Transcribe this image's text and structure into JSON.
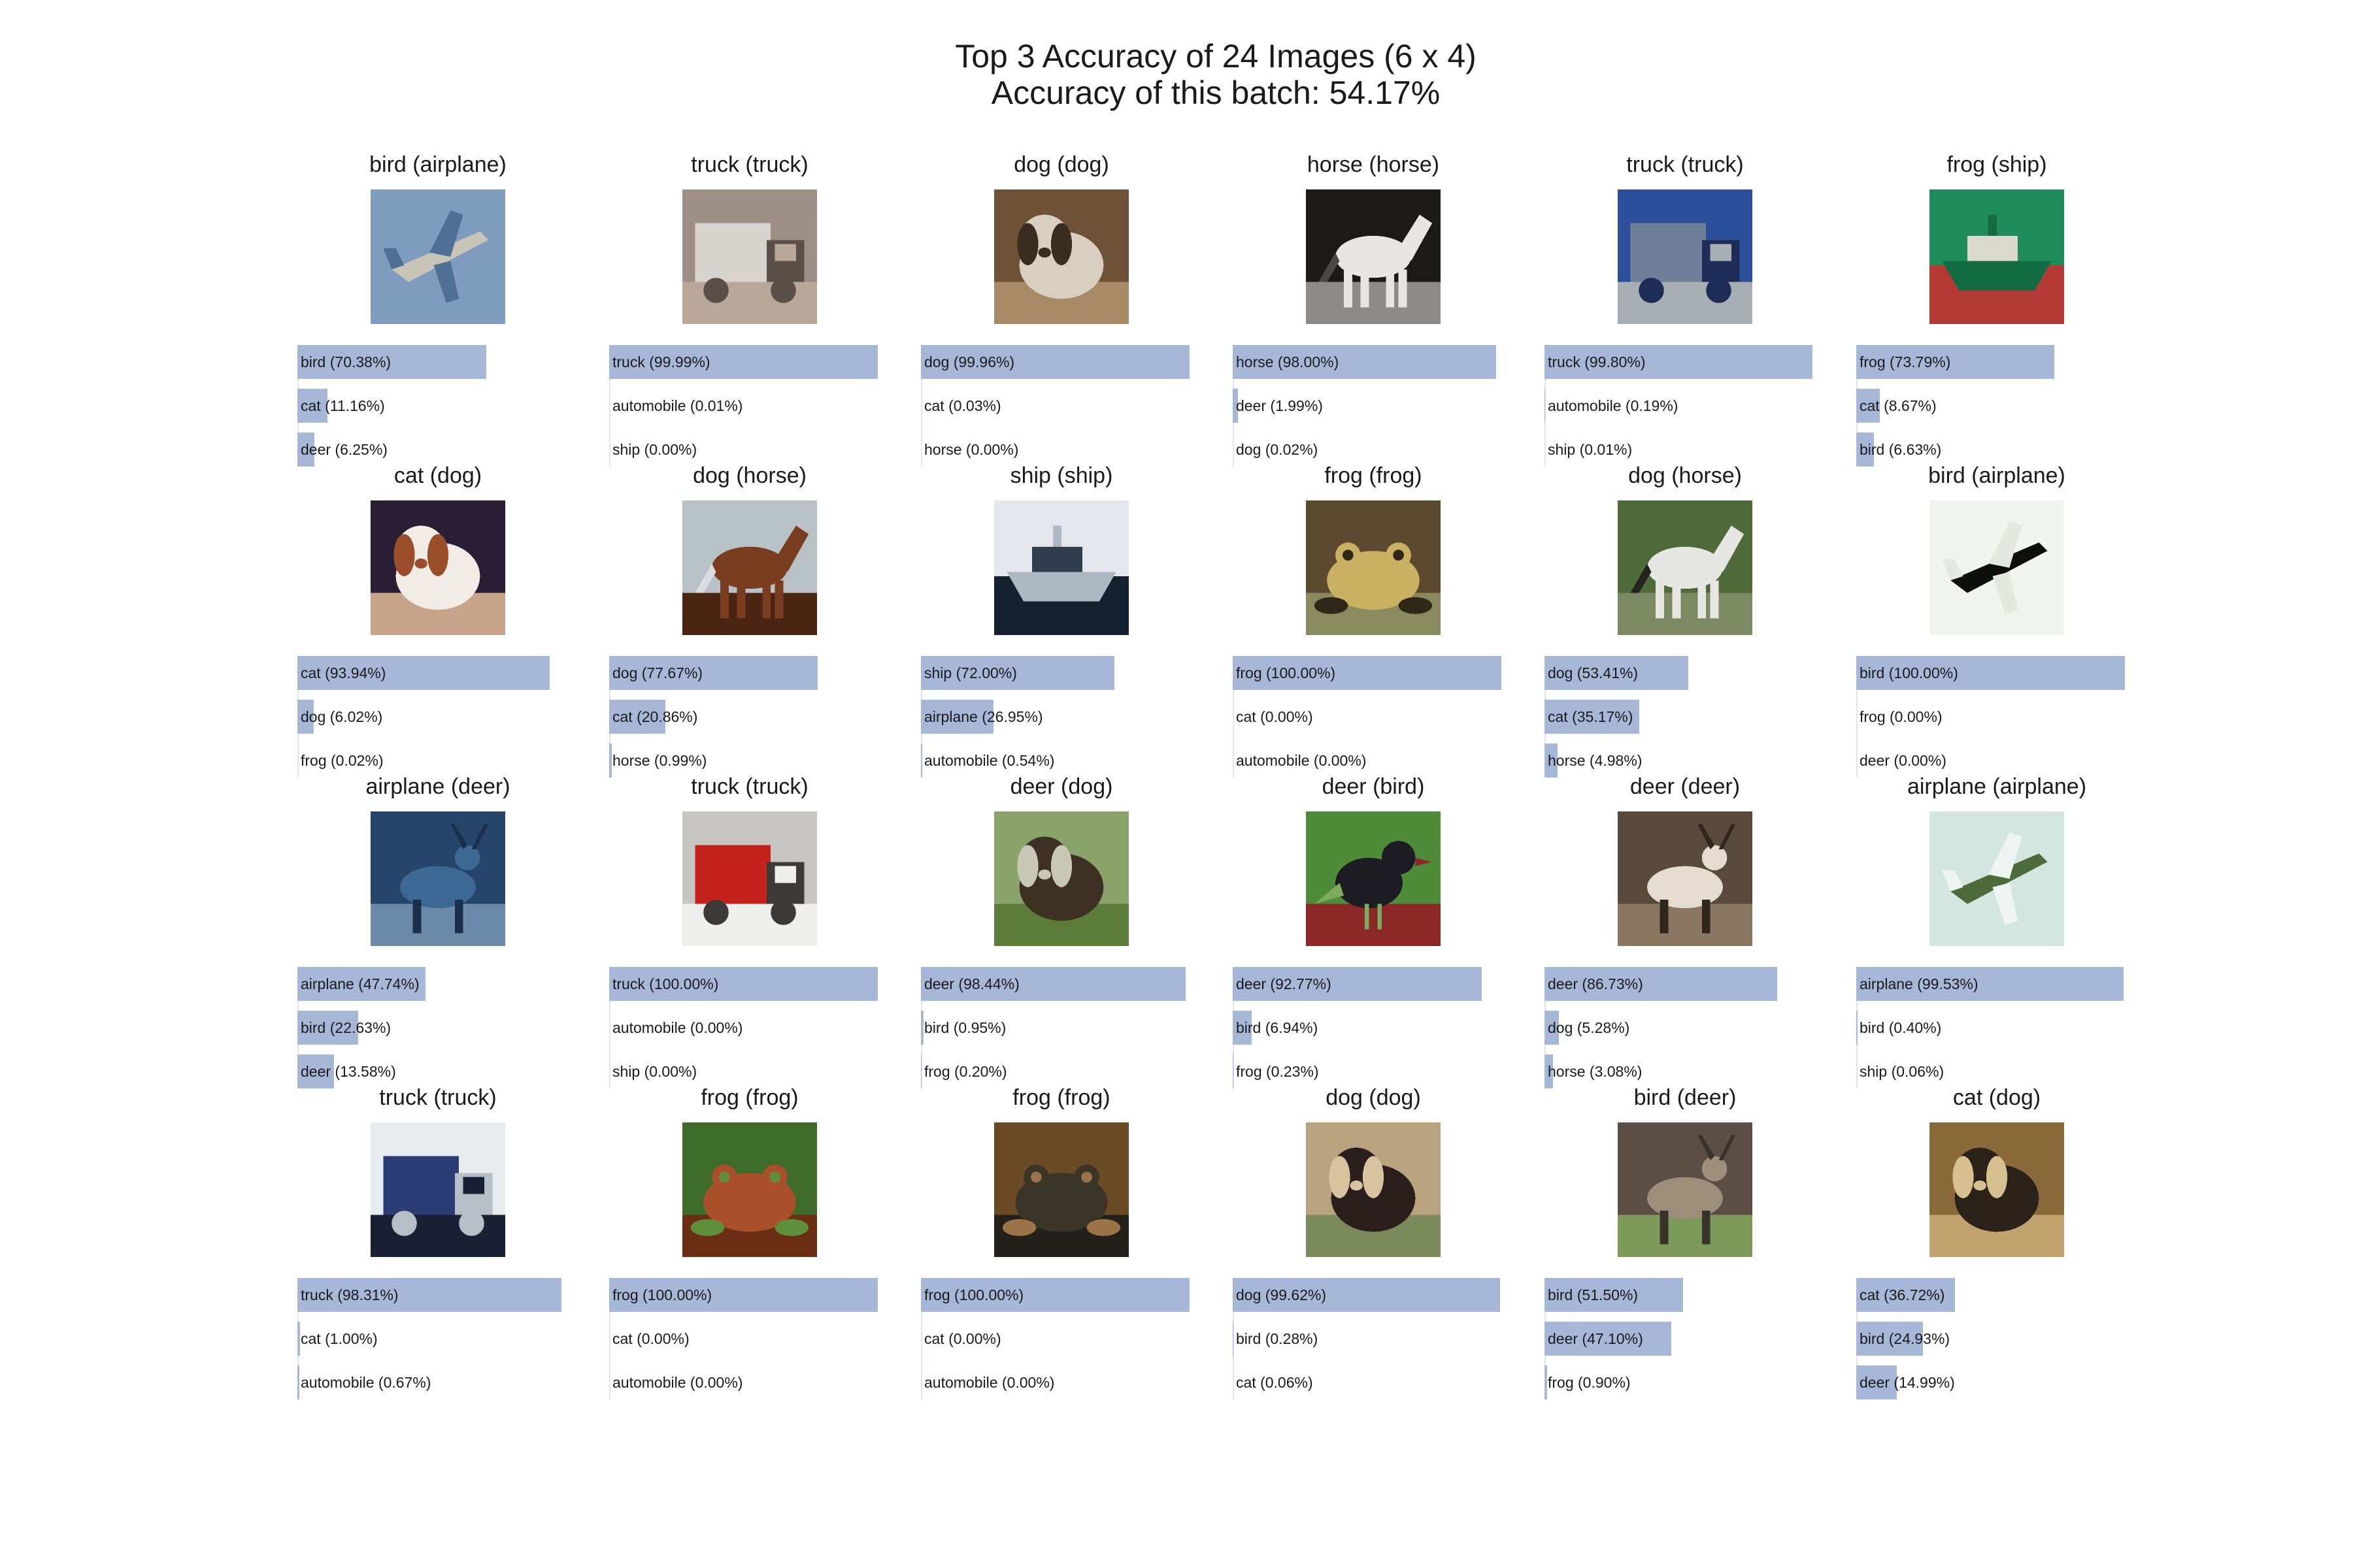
{
  "title_line1": "Top 3 Accuracy of 24 Images (6 x 4)",
  "title_line2": "Accuracy of this batch: 54.17%",
  "chart_data": {
    "type": "bar",
    "grid": false,
    "layout": "6 columns x 4 rows of image panels, each with a horizontal top-3 probability bar chart",
    "colors": {
      "bar": "#a6b7d8",
      "text": "#1a1a1a"
    },
    "cells": [
      {
        "title": "bird (airplane)",
        "image": "airplane",
        "palette": [
          "#7f9cbf",
          "#c9c4b8",
          "#4f6f94",
          "#9fb6cf"
        ],
        "preds": [
          {
            "label": "bird (70.38%)",
            "value": 70.38
          },
          {
            "label": "cat (11.16%)",
            "value": 11.16
          },
          {
            "label": "deer (6.25%)",
            "value": 6.25
          }
        ]
      },
      {
        "title": "truck (truck)",
        "image": "truck",
        "palette": [
          "#9e8f86",
          "#d7d4d0",
          "#5b4f49",
          "#b9a79a"
        ],
        "preds": [
          {
            "label": "truck (99.99%)",
            "value": 99.99
          },
          {
            "label": "automobile (0.01%)",
            "value": 0.01
          },
          {
            "label": "ship (0.00%)",
            "value": 0.0
          }
        ]
      },
      {
        "title": "dog (dog)",
        "image": "dog",
        "palette": [
          "#6e5238",
          "#d8cfc1",
          "#3a2c1f",
          "#a98a66"
        ],
        "preds": [
          {
            "label": "dog (99.96%)",
            "value": 99.96
          },
          {
            "label": "cat (0.03%)",
            "value": 0.03
          },
          {
            "label": "horse (0.00%)",
            "value": 0.0
          }
        ]
      },
      {
        "title": "horse (horse)",
        "image": "horse",
        "palette": [
          "#1b1a19",
          "#e8e6e3",
          "#4a4745",
          "#8d8a87"
        ],
        "preds": [
          {
            "label": "horse (98.00%)",
            "value": 98.0
          },
          {
            "label": "deer (1.99%)",
            "value": 1.99
          },
          {
            "label": "dog (0.02%)",
            "value": 0.02
          }
        ]
      },
      {
        "title": "truck (truck)",
        "image": "truck",
        "palette": [
          "#2c4f9a",
          "#6f7f9a",
          "#1d2d57",
          "#a7aeb4"
        ],
        "preds": [
          {
            "label": "truck (99.80%)",
            "value": 99.8
          },
          {
            "label": "automobile (0.19%)",
            "value": 0.19
          },
          {
            "label": "ship (0.01%)",
            "value": 0.01
          }
        ]
      },
      {
        "title": "frog (ship)",
        "image": "ship",
        "palette": [
          "#1f8a5a",
          "#d9d9cf",
          "#126b43",
          "#b43a36"
        ],
        "preds": [
          {
            "label": "frog (73.79%)",
            "value": 73.79
          },
          {
            "label": "cat (8.67%)",
            "value": 8.67
          },
          {
            "label": "bird (6.63%)",
            "value": 6.63
          }
        ]
      },
      {
        "title": "cat (dog)",
        "image": "dog",
        "palette": [
          "#2a1e35",
          "#f1ece6",
          "#9b4e2a",
          "#c7a48a"
        ],
        "preds": [
          {
            "label": "cat (93.94%)",
            "value": 93.94
          },
          {
            "label": "dog (6.02%)",
            "value": 6.02
          },
          {
            "label": "frog (0.02%)",
            "value": 0.02
          }
        ]
      },
      {
        "title": "dog (horse)",
        "image": "horse",
        "palette": [
          "#b8c1c6",
          "#7a3d20",
          "#d9dde0",
          "#4a2412"
        ],
        "preds": [
          {
            "label": "dog (77.67%)",
            "value": 77.67
          },
          {
            "label": "cat (20.86%)",
            "value": 20.86
          },
          {
            "label": "horse (0.99%)",
            "value": 0.99
          }
        ]
      },
      {
        "title": "ship (ship)",
        "image": "ship",
        "palette": [
          "#e4e8ee",
          "#2f3d4c",
          "#aeb8c4",
          "#14212e"
        ],
        "preds": [
          {
            "label": "ship (72.00%)",
            "value": 72.0
          },
          {
            "label": "airplane (26.95%)",
            "value": 26.95
          },
          {
            "label": "automobile (0.54%)",
            "value": 0.54
          }
        ]
      },
      {
        "title": "frog (frog)",
        "image": "frog",
        "palette": [
          "#5b4a30",
          "#c9b063",
          "#2f2718",
          "#8a8a5e"
        ],
        "preds": [
          {
            "label": "frog (100.00%)",
            "value": 100.0
          },
          {
            "label": "cat (0.00%)",
            "value": 0.0
          },
          {
            "label": "automobile (0.00%)",
            "value": 0.0
          }
        ]
      },
      {
        "title": "dog (horse)",
        "image": "horse",
        "palette": [
          "#4f6b3a",
          "#e6e7e2",
          "#24231f",
          "#7c8a63"
        ],
        "preds": [
          {
            "label": "dog (53.41%)",
            "value": 53.41
          },
          {
            "label": "cat (35.17%)",
            "value": 35.17
          },
          {
            "label": "horse (4.98%)",
            "value": 4.98
          }
        ]
      },
      {
        "title": "bird (airplane)",
        "image": "airplane",
        "palette": [
          "#f2f4ef",
          "#0d0f0c",
          "#e5e8e0",
          "#3a3c38"
        ],
        "preds": [
          {
            "label": "bird (100.00%)",
            "value": 100.0
          },
          {
            "label": "frog (0.00%)",
            "value": 0.0
          },
          {
            "label": "deer (0.00%)",
            "value": 0.0
          }
        ]
      },
      {
        "title": "airplane (deer)",
        "image": "deer",
        "palette": [
          "#27456b",
          "#3d6a95",
          "#1a2f4a",
          "#6b88a8"
        ],
        "preds": [
          {
            "label": "airplane (47.74%)",
            "value": 47.74
          },
          {
            "label": "bird (22.63%)",
            "value": 22.63
          },
          {
            "label": "deer (13.58%)",
            "value": 13.58
          }
        ]
      },
      {
        "title": "truck (truck)",
        "image": "truck",
        "palette": [
          "#c8c6c2",
          "#c4221d",
          "#3c3a37",
          "#eeeeec"
        ],
        "preds": [
          {
            "label": "truck (100.00%)",
            "value": 100.0
          },
          {
            "label": "automobile (0.00%)",
            "value": 0.0
          },
          {
            "label": "ship (0.00%)",
            "value": 0.0
          }
        ]
      },
      {
        "title": "deer (dog)",
        "image": "dog",
        "palette": [
          "#8aa36a",
          "#3e3022",
          "#c9c7b6",
          "#5b7d39"
        ],
        "preds": [
          {
            "label": "deer (98.44%)",
            "value": 98.44
          },
          {
            "label": "bird (0.95%)",
            "value": 0.95
          },
          {
            "label": "frog (0.20%)",
            "value": 0.2
          }
        ]
      },
      {
        "title": "deer (bird)",
        "image": "bird",
        "palette": [
          "#4f8c3a",
          "#1c1c22",
          "#7eaa5d",
          "#8b2727"
        ],
        "preds": [
          {
            "label": "deer (92.77%)",
            "value": 92.77
          },
          {
            "label": "bird (6.94%)",
            "value": 6.94
          },
          {
            "label": "frog (0.23%)",
            "value": 0.23
          }
        ]
      },
      {
        "title": "deer (deer)",
        "image": "deer",
        "palette": [
          "#5a4a3b",
          "#e3dccf",
          "#2f261d",
          "#8b7863"
        ],
        "preds": [
          {
            "label": "deer (86.73%)",
            "value": 86.73
          },
          {
            "label": "dog (5.28%)",
            "value": 5.28
          },
          {
            "label": "horse (3.08%)",
            "value": 3.08
          }
        ]
      },
      {
        "title": "airplane (airplane)",
        "image": "airplane",
        "palette": [
          "#d4e6e0",
          "#4d6b3b",
          "#eef5f2",
          "#2f4223"
        ],
        "preds": [
          {
            "label": "airplane (99.53%)",
            "value": 99.53
          },
          {
            "label": "bird (0.40%)",
            "value": 0.4
          },
          {
            "label": "ship (0.06%)",
            "value": 0.06
          }
        ]
      },
      {
        "title": "truck (truck)",
        "image": "truck",
        "palette": [
          "#e9ecef",
          "#2b3c74",
          "#b8bec6",
          "#1a1f33"
        ],
        "preds": [
          {
            "label": "truck (98.31%)",
            "value": 98.31
          },
          {
            "label": "cat (1.00%)",
            "value": 1.0
          },
          {
            "label": "automobile (0.67%)",
            "value": 0.67
          }
        ]
      },
      {
        "title": "frog (frog)",
        "image": "frog",
        "palette": [
          "#3f6b2a",
          "#a9502a",
          "#5f8f3b",
          "#6b2d14"
        ],
        "preds": [
          {
            "label": "frog (100.00%)",
            "value": 100.0
          },
          {
            "label": "cat (0.00%)",
            "value": 0.0
          },
          {
            "label": "automobile (0.00%)",
            "value": 0.0
          }
        ]
      },
      {
        "title": "frog (frog)",
        "image": "frog",
        "palette": [
          "#6b4a26",
          "#3b3528",
          "#9a7446",
          "#24201a"
        ],
        "preds": [
          {
            "label": "frog (100.00%)",
            "value": 100.0
          },
          {
            "label": "cat (0.00%)",
            "value": 0.0
          },
          {
            "label": "automobile (0.00%)",
            "value": 0.0
          }
        ]
      },
      {
        "title": "dog (dog)",
        "image": "dog",
        "palette": [
          "#b9a27e",
          "#2a1f1c",
          "#d8c4a0",
          "#7a8a5a"
        ],
        "preds": [
          {
            "label": "dog (99.62%)",
            "value": 99.62
          },
          {
            "label": "bird (0.28%)",
            "value": 0.28
          },
          {
            "label": "cat (0.06%)",
            "value": 0.06
          }
        ]
      },
      {
        "title": "bird (deer)",
        "image": "deer",
        "palette": [
          "#5b4e44",
          "#9c8e78",
          "#3a332c",
          "#7d9a5b"
        ],
        "preds": [
          {
            "label": "bird (51.50%)",
            "value": 51.5
          },
          {
            "label": "deer (47.10%)",
            "value": 47.1
          },
          {
            "label": "frog (0.90%)",
            "value": 0.9
          }
        ]
      },
      {
        "title": "cat (dog)",
        "image": "dog",
        "palette": [
          "#8a6a3a",
          "#2b221a",
          "#d6c08f",
          "#c2a36e"
        ],
        "preds": [
          {
            "label": "cat (36.72%)",
            "value": 36.72
          },
          {
            "label": "bird (24.93%)",
            "value": 24.93
          },
          {
            "label": "deer (14.99%)",
            "value": 14.99
          }
        ]
      }
    ]
  }
}
